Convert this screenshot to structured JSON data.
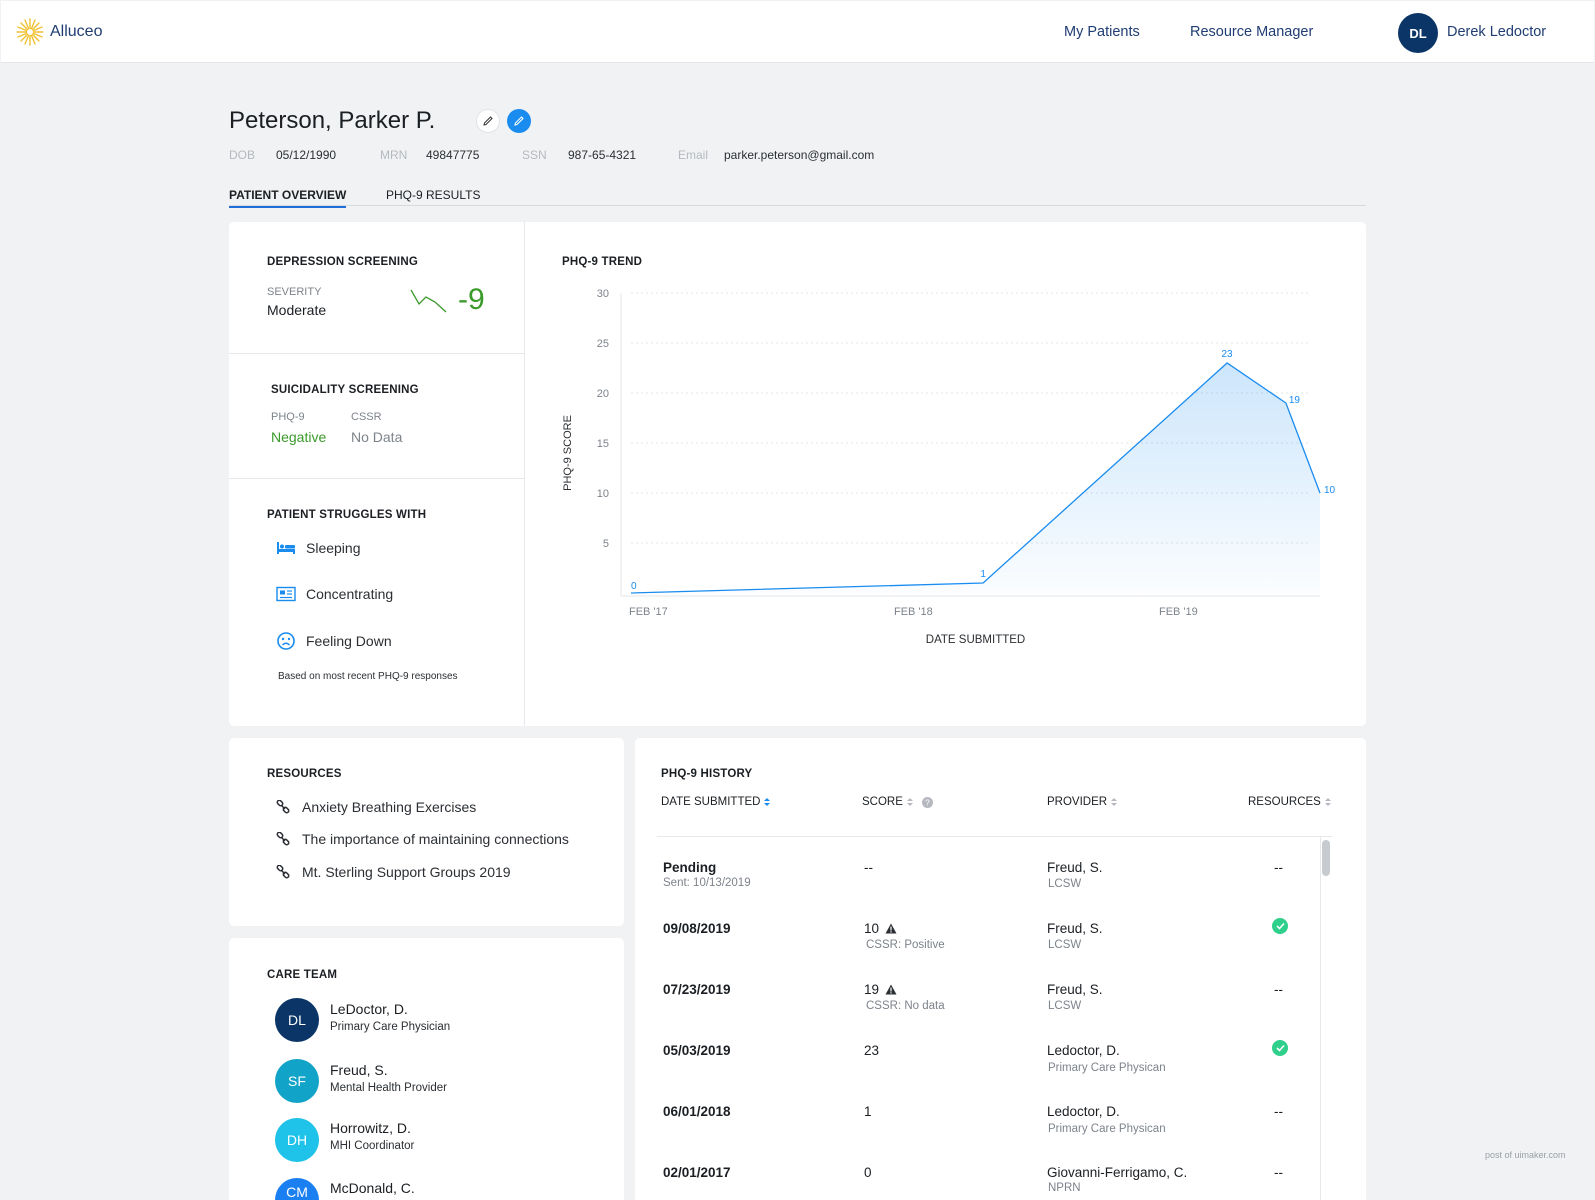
{
  "app": {
    "brand": "Alluceo"
  },
  "nav": {
    "my_patients": "My Patients",
    "resource_manager": "Resource Manager"
  },
  "user": {
    "initials": "DL",
    "name": "Derek Ledoctor"
  },
  "patient": {
    "name": "Peterson, Parker P.",
    "dob_label": "DOB",
    "dob": "05/12/1990",
    "mrn_label": "MRN",
    "mrn": "49847775",
    "ssn_label": "SSN",
    "ssn": "987-65-4321",
    "email_label": "Email",
    "email": "parker.peterson@gmail.com"
  },
  "tabs": [
    {
      "label": "PATIENT OVERVIEW",
      "active": true
    },
    {
      "label": "PHQ-9 RESULTS",
      "active": false
    }
  ],
  "depression": {
    "title": "DEPRESSION SCREENING",
    "severity_label": "SEVERITY",
    "severity": "Moderate",
    "change": "-9",
    "change_color": "#3a9a2a"
  },
  "suicidality": {
    "title": "SUICIDALITY SCREENING",
    "phq_label": "PHQ-9",
    "phq_value": "Negative",
    "cssr_label": "CSSR",
    "cssr_value": "No Data"
  },
  "struggles": {
    "title": "PATIENT STRUGGLES WITH",
    "items": [
      {
        "label": "Sleeping",
        "icon": "bed-icon"
      },
      {
        "label": "Concentrating",
        "icon": "newspaper-icon"
      },
      {
        "label": "Feeling Down",
        "icon": "sad-face-icon"
      }
    ],
    "note": "Based on most recent PHQ-9 responses"
  },
  "trend": {
    "title": "PHQ-9 TREND"
  },
  "chart_data": {
    "type": "area",
    "ylabel": "PHQ-9 SCORE",
    "xlabel": "DATE SUBMITTED",
    "x": [
      "2017-02-01",
      "2018-06-01",
      "2019-05-03",
      "2019-07-23",
      "2019-09-08"
    ],
    "values": [
      0,
      1,
      23,
      19,
      10
    ],
    "yticks": [
      5,
      10,
      15,
      20,
      25,
      30
    ],
    "xticks": [
      {
        "label": "FEB '17",
        "date": "2017-02-01"
      },
      {
        "label": "FEB '18",
        "date": "2018-02-01"
      },
      {
        "label": "FEB '19",
        "date": "2019-02-01"
      }
    ],
    "ylim": [
      0,
      30
    ],
    "xlim": [
      "2017-02-01",
      "2019-09-08"
    ],
    "grid": true,
    "color": "#1a8cf0"
  },
  "resources": {
    "title": "RESOURCES",
    "items": [
      "Anxiety Breathing Exercises",
      "The importance of maintaining connections",
      "Mt. Sterling Support Groups 2019"
    ]
  },
  "care_team": {
    "title": "CARE TEAM",
    "members": [
      {
        "initials": "DL",
        "name": "LeDoctor, D.",
        "role": "Primary Care Physician",
        "color": "#0b3566"
      },
      {
        "initials": "SF",
        "name": "Freud, S.",
        "role": "Mental Health Provider",
        "color": "#12a3c8"
      },
      {
        "initials": "DH",
        "name": "Horrowitz, D.",
        "role": "MHI Coordinator",
        "color": "#1fc3ea"
      },
      {
        "initials": "CM",
        "name": "McDonald, C.",
        "role": "",
        "color": "#1a7ff0"
      }
    ]
  },
  "history": {
    "title": "PHQ-9 HISTORY",
    "columns": {
      "date": "DATE SUBMITTED",
      "score": "SCORE",
      "provider": "PROVIDER",
      "resources": "RESOURCES"
    },
    "rows": [
      {
        "date": "Pending",
        "sub": "Sent: 10/13/2019",
        "score": "--",
        "score_sub": "",
        "warn": false,
        "provider": "Freud, S.",
        "provider_role": "LCSW",
        "resources": "--",
        "has_resource": false
      },
      {
        "date": "09/08/2019",
        "sub": "",
        "score": "10",
        "score_sub": "CSSR: Positive",
        "warn": true,
        "provider": "Freud, S.",
        "provider_role": "LCSW",
        "resources": "",
        "has_resource": true
      },
      {
        "date": "07/23/2019",
        "sub": "",
        "score": "19",
        "score_sub": "CSSR: No data",
        "warn": true,
        "provider": "Freud, S.",
        "provider_role": "LCSW",
        "resources": "--",
        "has_resource": false
      },
      {
        "date": "05/03/2019",
        "sub": "",
        "score": "23",
        "score_sub": "",
        "warn": false,
        "provider": "Ledoctor, D.",
        "provider_role": "Primary Care Physican",
        "resources": "",
        "has_resource": true
      },
      {
        "date": "06/01/2018",
        "sub": "",
        "score": "1",
        "score_sub": "",
        "warn": false,
        "provider": "Ledoctor, D.",
        "provider_role": "Primary Care Physican",
        "resources": "--",
        "has_resource": false
      },
      {
        "date": "02/01/2017",
        "sub": "",
        "score": "0",
        "score_sub": "",
        "warn": false,
        "provider": "Giovanni-Ferrigamo, C.",
        "provider_role": "NPRN",
        "resources": "--",
        "has_resource": false
      }
    ]
  },
  "footer": {
    "watermark": "post of uimaker.com"
  }
}
